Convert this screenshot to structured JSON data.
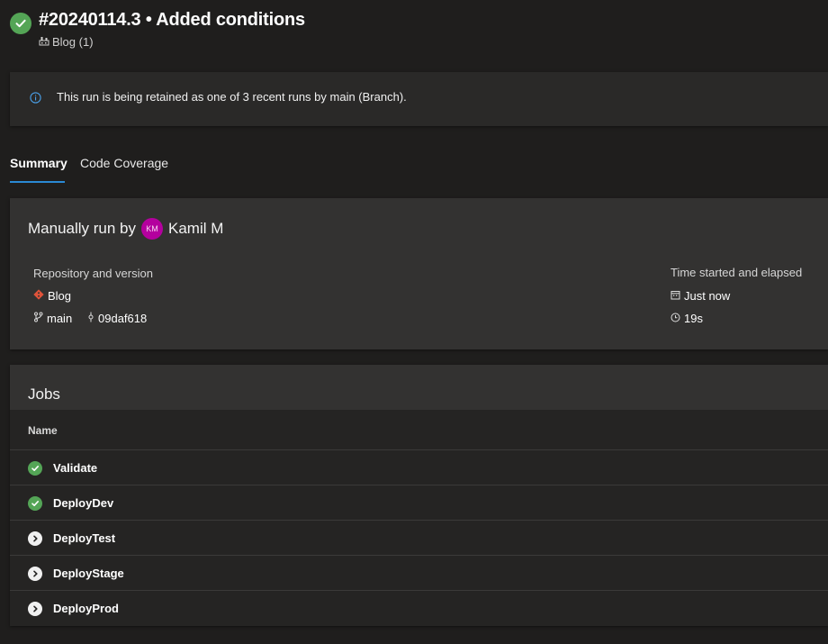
{
  "header": {
    "title": "#20240114.3 • Added conditions",
    "subtitle": "Blog (1)",
    "status_color": "#54a556"
  },
  "banner": {
    "message": "This run is being retained as one of 3 recent runs by main (Branch)."
  },
  "tabs": [
    {
      "label": "Summary",
      "selected": true
    },
    {
      "label": "Code Coverage",
      "selected": false
    }
  ],
  "summary": {
    "run_by_prefix": "Manually run by",
    "user_initials": "KM",
    "user_name": "Kamil M",
    "repo_heading": "Repository and version",
    "repo_name": "Blog",
    "branch": "main",
    "commit": "09daf618",
    "time_heading": "Time started and elapsed",
    "started": "Just now",
    "elapsed": "19s"
  },
  "jobs": {
    "title": "Jobs",
    "column_name": "Name",
    "items": [
      {
        "name": "Validate",
        "status": "succeeded"
      },
      {
        "name": "DeployDev",
        "status": "succeeded"
      },
      {
        "name": "DeployTest",
        "status": "pending"
      },
      {
        "name": "DeployStage",
        "status": "pending"
      },
      {
        "name": "DeployProd",
        "status": "pending"
      }
    ]
  },
  "colors": {
    "background": "#1f1e1d",
    "card": "#333231",
    "accent": "#2a8ad4",
    "success": "#54a556",
    "avatar": "#b4009e",
    "git": "#e0533a"
  }
}
